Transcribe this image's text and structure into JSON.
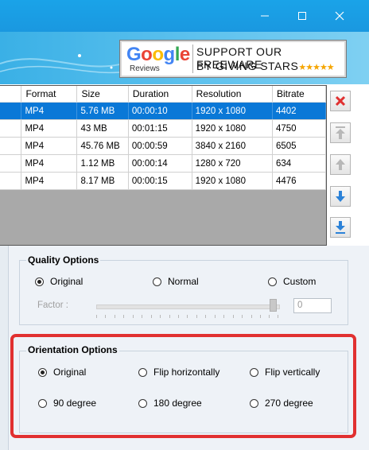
{
  "window": {
    "controls": {
      "minimize": "minimize-icon",
      "maximize": "maximize-icon",
      "close": "close-icon"
    }
  },
  "banner": {
    "google_text": "Google",
    "reviews_text": "Reviews",
    "line1": "SUPPORT OUR FREEWARE",
    "line2": "BY GIVING STARS",
    "stars": "★★★★★"
  },
  "file_list": {
    "columns": [
      "",
      "Format",
      "Size",
      "Duration",
      "Resolution",
      "Bitrate"
    ],
    "rows": [
      {
        "format": "MP4",
        "size": "5.76 MB",
        "duration": "00:00:10",
        "resolution": "1920 x 1080",
        "bitrate": "4402",
        "selected": true
      },
      {
        "format": "MP4",
        "size": "43 MB",
        "duration": "00:01:15",
        "resolution": "1920 x 1080",
        "bitrate": "4750",
        "selected": false
      },
      {
        "format": "MP4",
        "size": "45.76 MB",
        "duration": "00:00:59",
        "resolution": "3840 x 2160",
        "bitrate": "6505",
        "selected": false
      },
      {
        "format": "MP4",
        "size": "1.12 MB",
        "duration": "00:00:14",
        "resolution": "1280 x 720",
        "bitrate": "634",
        "selected": false
      },
      {
        "format": "MP4",
        "size": "8.17 MB",
        "duration": "00:00:15",
        "resolution": "1920 x 1080",
        "bitrate": "4476",
        "selected": false
      }
    ]
  },
  "side_buttons": [
    "remove-icon",
    "move-top-icon",
    "move-up-icon",
    "move-down-icon",
    "move-bottom-icon"
  ],
  "quality": {
    "title": "Quality Options",
    "options": [
      "Original",
      "Normal",
      "Custom"
    ],
    "selected": "Original",
    "factor_label": "Factor :",
    "factor_value": "0",
    "slider_level": 1.0
  },
  "orientation": {
    "title": "Orientation Options",
    "options": [
      "Original",
      "Flip horizontally",
      "Flip vertically",
      "90 degree",
      "180 degree",
      "270 degree"
    ],
    "selected": "Original"
  },
  "colors": {
    "titlebar": "#1aa3e8",
    "selection": "#0a78d7",
    "highlight": "#e13030"
  }
}
